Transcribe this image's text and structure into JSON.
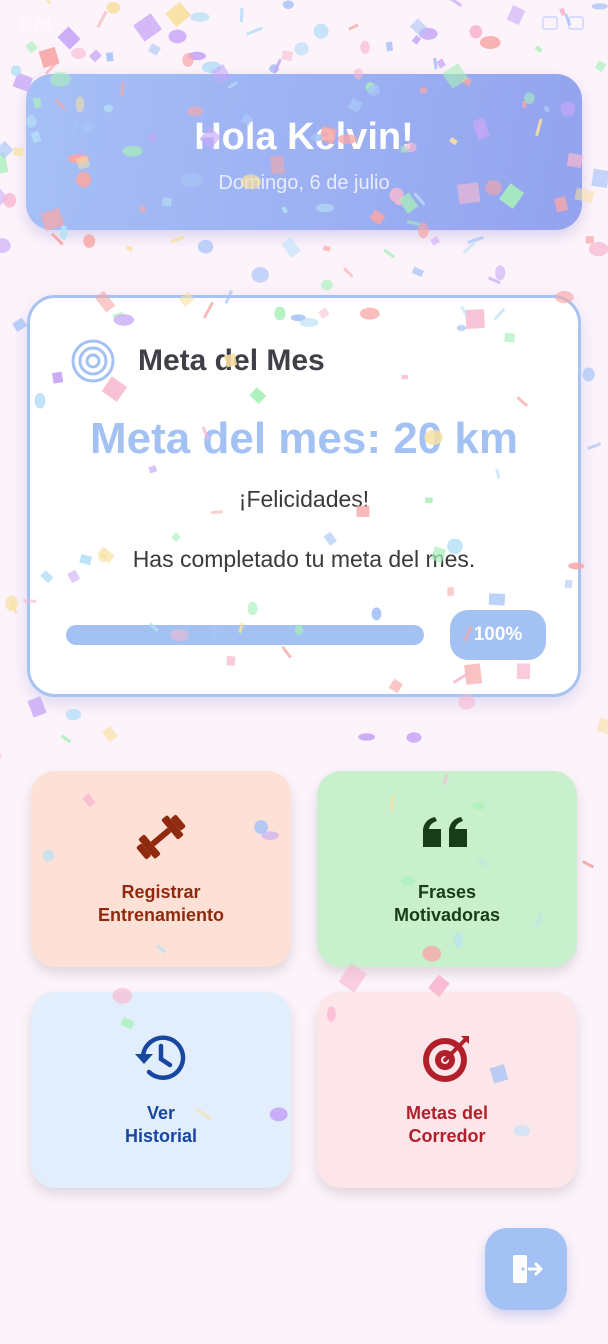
{
  "status_bar": {
    "time": "0:28"
  },
  "header": {
    "greeting": "Hola Kelvin!",
    "date": "Domingo, 6 de julio"
  },
  "goal_card": {
    "title": "Meta del Mes",
    "goal_text": "Meta del mes: 20 km",
    "congrats": "¡Felicidades!",
    "message": "Has completado tu meta del mes.",
    "progress_value": 100,
    "progress_label": "100%",
    "accent_color": "#a3c2f3",
    "icon": "target-icon"
  },
  "tiles": [
    {
      "label": "Registrar\nEntrenamiento",
      "icon": "dumbbell-icon",
      "color": "#fde1d7",
      "text_color": "#8f2a0e"
    },
    {
      "label": "Frases\nMotivadoras",
      "icon": "quote-icon",
      "color": "#c8f0cc",
      "text_color": "#173d18"
    },
    {
      "label": "Ver\nHistorial",
      "icon": "history-icon",
      "color": "#e2eefc",
      "text_color": "#1747a0"
    },
    {
      "label": "Metas del\nCorredor",
      "icon": "bullseye-icon",
      "color": "#fde6ea",
      "text_color": "#b11f2a"
    }
  ],
  "logout": {
    "icon": "logout-icon"
  }
}
